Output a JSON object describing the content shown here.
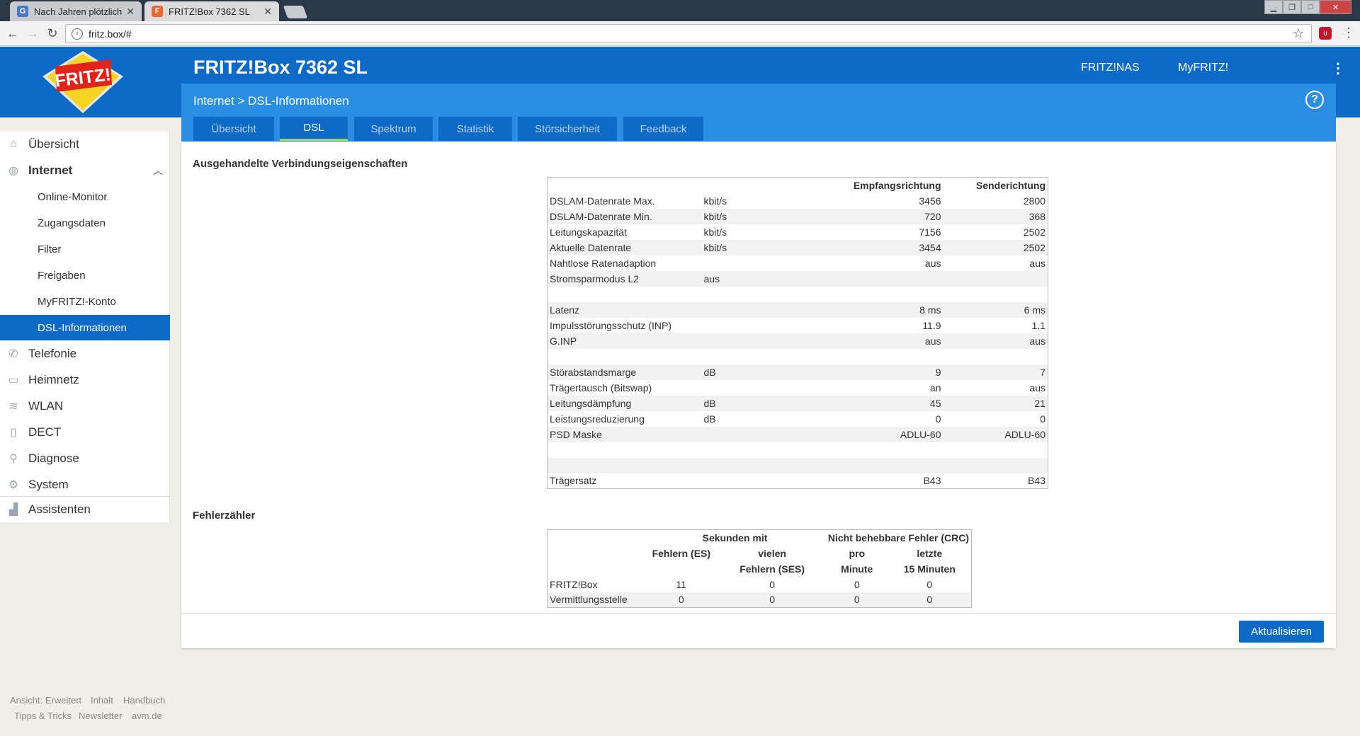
{
  "browser": {
    "tabs": [
      {
        "title": "Nach Jahren plötzlich ge",
        "active": false
      },
      {
        "title": "FRITZ!Box 7362 SL",
        "active": true
      }
    ],
    "url": "fritz.box/#"
  },
  "header": {
    "product": "FRITZ!Box 7362 SL",
    "links": [
      "FRITZ!NAS",
      "MyFRITZ!"
    ],
    "breadcrumb": "Internet > DSL-Informationen"
  },
  "tabs": [
    "Übersicht",
    "DSL",
    "Spektrum",
    "Statistik",
    "Störsicherheit",
    "Feedback"
  ],
  "active_tab": "DSL",
  "sidebar": {
    "items": [
      {
        "label": "Übersicht",
        "icon": "home-icon"
      },
      {
        "label": "Internet",
        "icon": "globe-icon"
      },
      {
        "label": "Telefonie",
        "icon": "phone-icon"
      },
      {
        "label": "Heimnetz",
        "icon": "network-icon"
      },
      {
        "label": "WLAN",
        "icon": "wifi-icon"
      },
      {
        "label": "DECT",
        "icon": "dect-phone-icon"
      },
      {
        "label": "Diagnose",
        "icon": "diagnose-icon"
      },
      {
        "label": "System",
        "icon": "gear-icon"
      },
      {
        "label": "Assistenten",
        "icon": "wizard-icon"
      }
    ],
    "internet_sub": [
      "Online-Monitor",
      "Zugangsdaten",
      "Filter",
      "Freigaben",
      "MyFRITZ!-Konto",
      "DSL-Informationen"
    ],
    "active_sub": "DSL-Informationen"
  },
  "section1": {
    "title": "Ausgehandelte Verbindungseigenschaften",
    "headers": [
      "Empfangsrichtung",
      "Senderichtung"
    ],
    "rows": [
      [
        "DSLAM-Datenrate Max.",
        "kbit/s",
        "3456",
        "2800"
      ],
      [
        "DSLAM-Datenrate Min.",
        "kbit/s",
        "720",
        "368"
      ],
      [
        "Leitungskapazität",
        "kbit/s",
        "7156",
        "2502"
      ],
      [
        "Aktuelle Datenrate",
        "kbit/s",
        "3454",
        "2502"
      ],
      [
        "Nahtlose Ratenadaption",
        "",
        "aus",
        "aus"
      ],
      [
        "Stromsparmodus L2",
        "aus",
        "",
        ""
      ],
      [
        "",
        "",
        "",
        ""
      ],
      [
        "Latenz",
        "",
        "8 ms",
        "6 ms"
      ],
      [
        "Impulsstörungsschutz (INP)",
        "",
        "11.9",
        "1.1"
      ],
      [
        "G.INP",
        "",
        "aus",
        "aus"
      ],
      [
        "",
        "",
        "",
        ""
      ],
      [
        "Störabstandsmarge",
        "dB",
        "9",
        "7"
      ],
      [
        "Trägertausch (Bitswap)",
        "",
        "an",
        "aus"
      ],
      [
        "Leitungsdämpfung",
        "dB",
        "45",
        "21"
      ],
      [
        "Leistungsreduzierung",
        "dB",
        "0",
        "0"
      ],
      [
        "PSD Maske",
        "",
        "ADLU-60",
        "ADLU-60"
      ],
      [
        "",
        "",
        "",
        ""
      ],
      [
        "",
        "",
        "",
        ""
      ],
      [
        "Trägersatz",
        "",
        "B43",
        "B43"
      ]
    ]
  },
  "section2": {
    "title": "Fehlerzähler",
    "group_headers": [
      "Sekunden mit",
      "Nicht behebbare Fehler (CRC)"
    ],
    "col_headers": [
      [
        "Fehlern (ES)",
        ""
      ],
      [
        "vielen",
        "Fehlern (SES)"
      ],
      [
        "pro",
        "Minute"
      ],
      [
        "letzte",
        "15 Minuten"
      ]
    ],
    "rows": [
      [
        "FRITZ!Box",
        "11",
        "0",
        "0",
        "0"
      ],
      [
        "Vermittlungsstelle",
        "0",
        "0",
        "0",
        "0"
      ]
    ]
  },
  "refresh_label": "Aktualisieren",
  "footer": {
    "row1": [
      "Ansicht: Erweitert",
      "Inhalt",
      "Handbuch"
    ],
    "row2": [
      "Tipps & Tricks",
      "Newsletter",
      "avm.de"
    ]
  },
  "colors": {
    "primary": "#0d6ac7",
    "subbar": "#2a8fe3",
    "tab_active_underline": "#a6d84a"
  }
}
